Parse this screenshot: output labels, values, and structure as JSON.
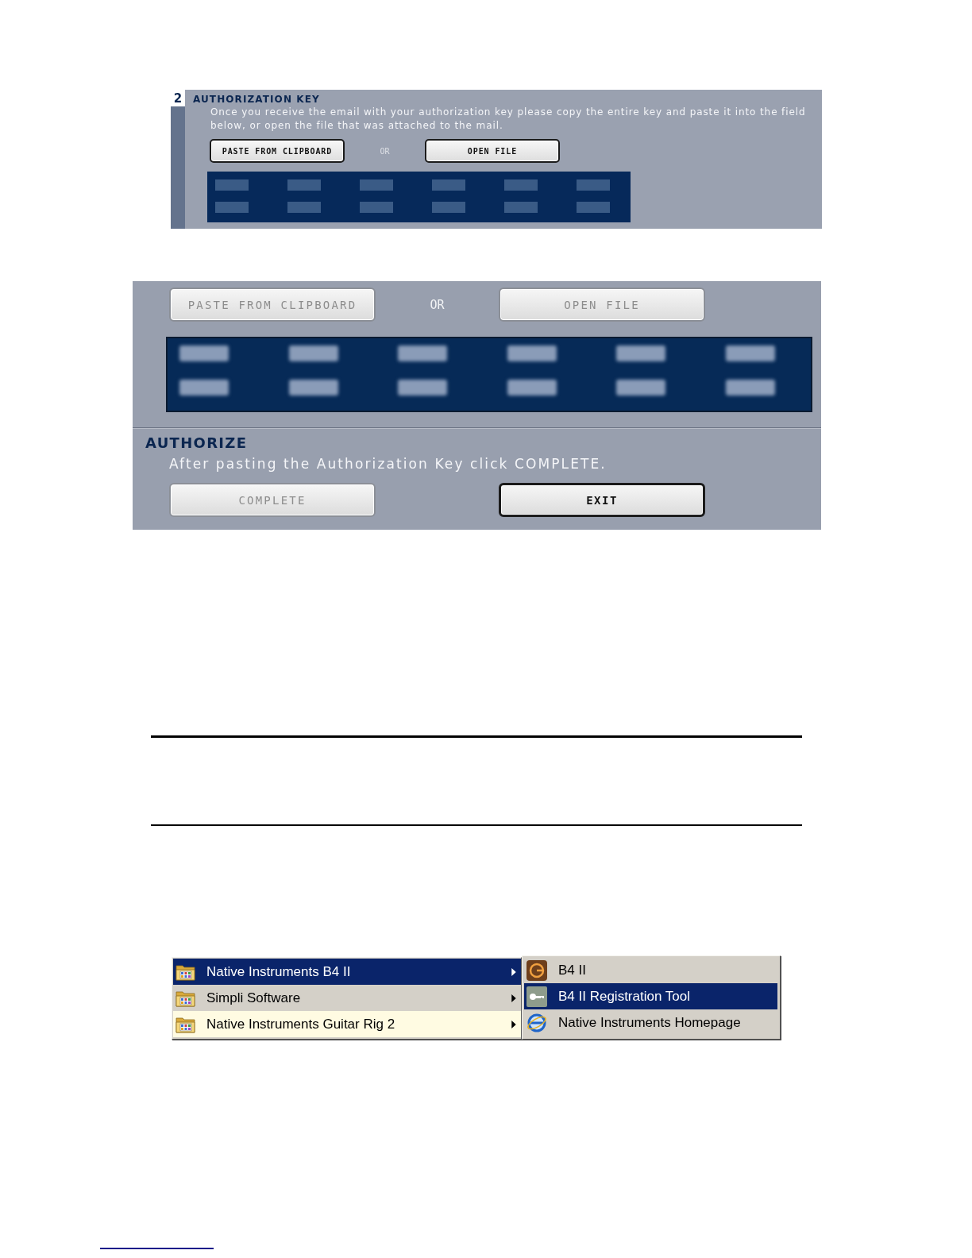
{
  "authorization_key_panel": {
    "step_number": "2",
    "title": "AUTHORIZATION KEY",
    "description": "Once you receive the email with your authorization key please copy the entire key and paste it into the field below, or open the file that was attached to the mail.",
    "buttons": [
      {
        "label": "PASTE FROM CLIPBOARD",
        "disabled": false
      },
      {
        "label": "OPEN FILE",
        "disabled": false
      }
    ],
    "separator": "OR",
    "key_field": {
      "rows": [
        [
          {
            "filled": false
          },
          {
            "filled": false
          },
          {
            "filled": false
          },
          {
            "filled": false
          },
          {
            "filled": false
          },
          {
            "filled": false
          }
        ],
        [
          {
            "filled": false
          },
          {
            "filled": false
          },
          {
            "filled": false
          },
          {
            "filled": false
          },
          {
            "filled": false
          },
          {
            "filled": false
          }
        ]
      ]
    }
  },
  "authorize_panel": {
    "buttons": [
      {
        "label": "PASTE FROM CLIPBOARD",
        "disabled": true
      },
      {
        "label": "OPEN FILE",
        "disabled": true
      }
    ],
    "separator": "OR",
    "key_field": {
      "rows": [
        [
          {
            "filled": true
          },
          {
            "filled": true
          },
          {
            "filled": true
          },
          {
            "filled": true
          },
          {
            "filled": true
          },
          {
            "filled": true
          }
        ],
        [
          {
            "filled": true
          },
          {
            "filled": true
          },
          {
            "filled": true
          },
          {
            "filled": true
          },
          {
            "filled": true
          },
          {
            "filled": true
          }
        ]
      ]
    },
    "title": "AUTHORIZE",
    "instruction": "After pasting the Authorization Key click COMPLETE.",
    "actions": [
      {
        "label": "COMPLETE",
        "disabled": true
      },
      {
        "label": "EXIT",
        "disabled": false
      }
    ]
  },
  "start_menu": {
    "items": [
      {
        "label": "Native Instruments B4 II",
        "selected": true,
        "newly_installed": false,
        "has_submenu": true
      },
      {
        "label": "Simpli Software",
        "selected": false,
        "newly_installed": false,
        "has_submenu": true
      },
      {
        "label": "Native Instruments Guitar Rig 2",
        "selected": false,
        "newly_installed": true,
        "has_submenu": true
      }
    ],
    "submenu": {
      "items": [
        {
          "label": "B4 II",
          "selected": false
        },
        {
          "label": "B4 II Registration Tool",
          "selected": true
        },
        {
          "label": "Native Instruments Homepage",
          "selected": false
        }
      ]
    }
  }
}
